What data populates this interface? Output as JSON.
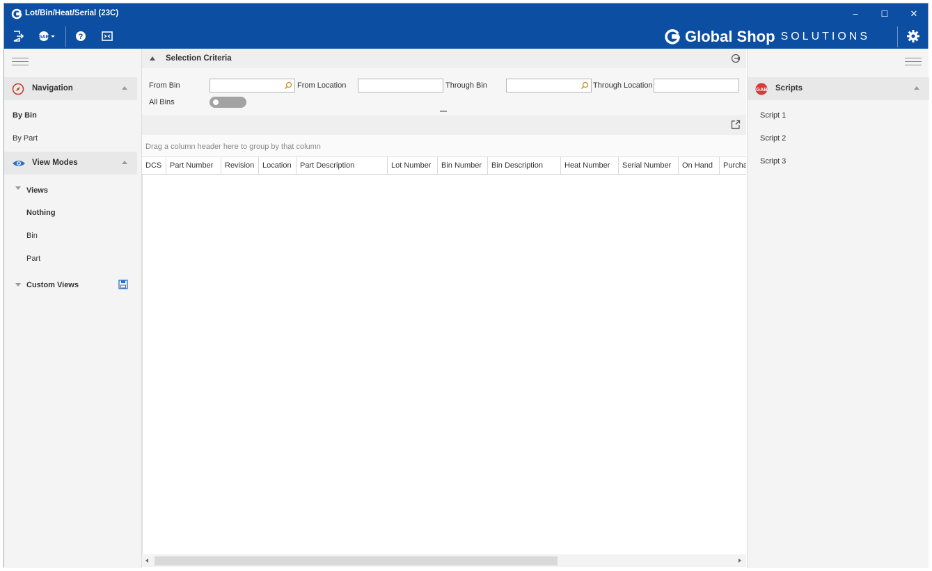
{
  "window": {
    "title": "Lot/Bin/Heat/Serial  (23C)",
    "controls": {
      "minimize": "–",
      "maximize": "☐",
      "close": "✕"
    }
  },
  "toolbar": {
    "icons": [
      "exit-icon",
      "gab-dropdown-icon",
      "help-icon",
      "screen-icon"
    ],
    "brand": {
      "global_shop": "Global Shop",
      "solutions": "SOLUTIONS"
    },
    "settings_icon": "gear-icon"
  },
  "colors": {
    "title_bar": "#0b4ea2",
    "accent_blue": "#2e6fc0",
    "gab_red": "#d93a3a"
  },
  "left_panel": {
    "navigation": {
      "title": "Navigation",
      "items": [
        {
          "label": "By Bin",
          "selected": true
        },
        {
          "label": "By Part",
          "selected": false
        }
      ]
    },
    "view_modes": {
      "title": "View Modes",
      "views_label": "Views",
      "views": [
        {
          "label": "Nothing",
          "selected": true
        },
        {
          "label": "Bin",
          "selected": false
        },
        {
          "label": "Part",
          "selected": false
        }
      ],
      "custom_views_label": "Custom Views"
    }
  },
  "criteria": {
    "title": "Selection Criteria",
    "from_bin": {
      "label": "From Bin",
      "value": ""
    },
    "from_location": {
      "label": "From Location",
      "value": ""
    },
    "through_bin": {
      "label": "Through Bin",
      "value": ""
    },
    "through_location": {
      "label": "Through Location",
      "value": ""
    },
    "all_bins": {
      "label": "All Bins",
      "on": false
    }
  },
  "grid": {
    "group_panel_text": "Drag a column header here to group by that column",
    "columns": [
      "DCS",
      "Part Number",
      "Revision",
      "Location",
      "Part Description",
      "Lot Number",
      "Bin Number",
      "Bin Description",
      "Heat Number",
      "Serial Number",
      "On Hand",
      "Purcha"
    ],
    "rows": []
  },
  "right_panel": {
    "title": "Scripts",
    "scripts": [
      "Script 1",
      "Script 2",
      "Script 3"
    ]
  }
}
